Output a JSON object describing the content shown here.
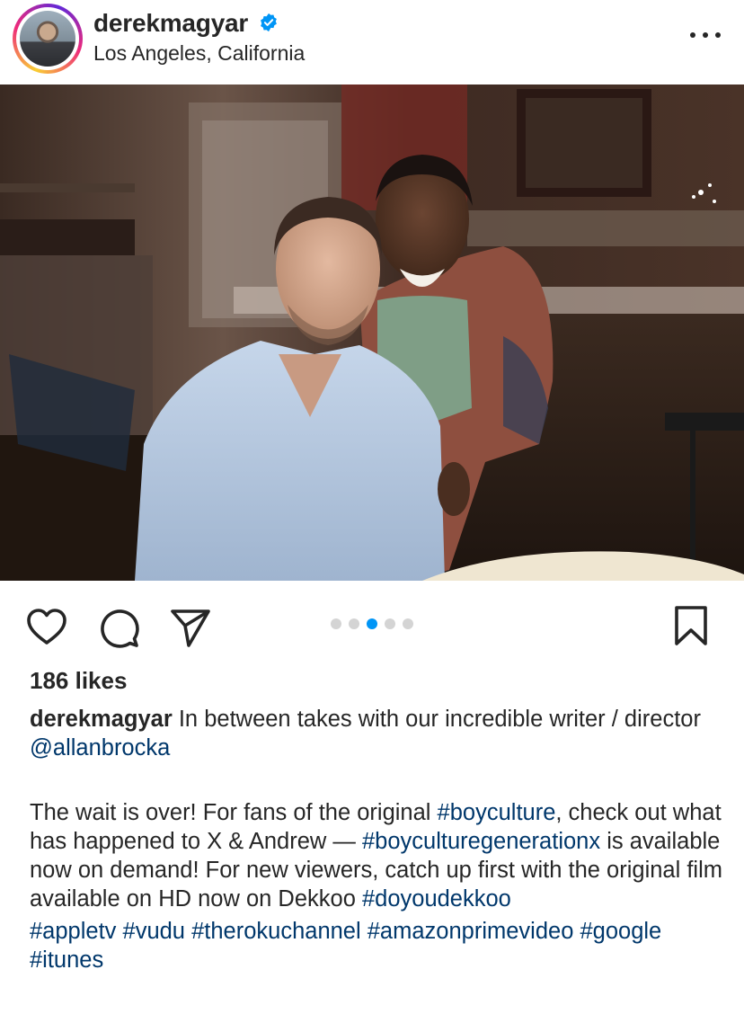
{
  "post": {
    "username": "derekmagyar",
    "location": "Los Angeles, California",
    "verified": true,
    "image_alt": "Two men posing together in a dimly lit kitchen set",
    "carousel": {
      "count": 5,
      "active_index": 2
    },
    "likes": "186 likes",
    "caption": {
      "username": "derekmagyar",
      "line1_text": " In between takes with our incredible writer / director ",
      "mention": "@allanbrocka",
      "p2_a": "The wait is over! For fans of the original ",
      "tag_boyculture": "#boyculture",
      "p2_b": ", check out what has happened to X & Andrew — ",
      "tag_bcgx": "#boyculturegenerationx",
      "p2_c": " is available now on demand! For new viewers, catch up first with the original film available on HD now on Dekkoo ",
      "tag_doyoudekkoo": "#doyoudekkoo",
      "tags": [
        "#appletv",
        "#vudu",
        "#therokuchannel",
        "#amazonprimevideo",
        "#google",
        "#itunes"
      ]
    }
  },
  "icons": {
    "like": "heart-icon",
    "comment": "comment-icon",
    "share": "send-icon",
    "save": "bookmark-icon",
    "more": "more-icon",
    "verified": "verified-badge-icon"
  },
  "colors": {
    "link": "#00376b",
    "active_dot": "#0095f6",
    "verified": "#0095f6"
  }
}
